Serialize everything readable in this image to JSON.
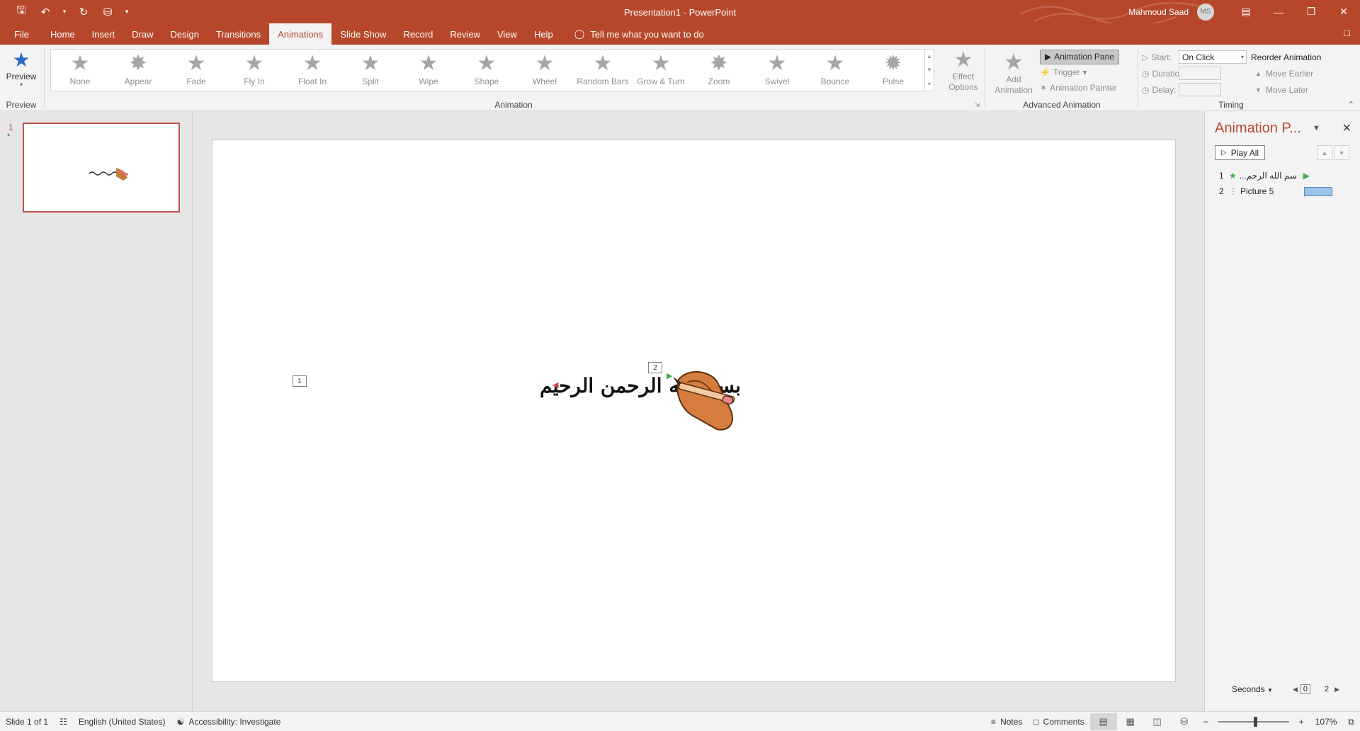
{
  "titlebar": {
    "doc_title": "Presentation1  -  PowerPoint",
    "user_name": "Mahmoud Saad",
    "user_initials": "MS"
  },
  "tabs": {
    "file": "File",
    "items": [
      "Home",
      "Insert",
      "Draw",
      "Design",
      "Transitions",
      "Animations",
      "Slide Show",
      "Record",
      "Review",
      "View",
      "Help"
    ],
    "active": "Animations",
    "tell_me": "Tell me what you want to do"
  },
  "ribbon": {
    "preview": {
      "label": "Preview",
      "group": "Preview"
    },
    "animation_group": "Animation",
    "gallery": [
      "None",
      "Appear",
      "Fade",
      "Fly In",
      "Float In",
      "Split",
      "Wipe",
      "Shape",
      "Wheel",
      "Random Bars",
      "Grow & Turn",
      "Zoom",
      "Swivel",
      "Bounce",
      "Pulse"
    ],
    "effect_options": "Effect Options",
    "advanced": {
      "group": "Advanced Animation",
      "add_animation": "Add Animation",
      "animation_pane": "Animation Pane",
      "trigger": "Trigger",
      "animation_painter": "Animation Painter"
    },
    "timing": {
      "group": "Timing",
      "start_label": "Start:",
      "start_value": "On Click",
      "duration_label": "Duration:",
      "delay_label": "Delay:",
      "reorder": "Reorder Animation",
      "move_earlier": "Move Earlier",
      "move_later": "Move Later"
    }
  },
  "thumbnails": {
    "number": "1",
    "star": "*"
  },
  "slide": {
    "tag1": "1",
    "tag2": "2",
    "calligraphy": "بسم الله الرحمن الرحيم"
  },
  "anim_pane": {
    "title": "Animation P...",
    "play_all": "Play All",
    "items": [
      {
        "num": "1",
        "name": "...بسم الله الرحم",
        "effect_color": "#3fae49"
      },
      {
        "num": "2",
        "name": "Picture 5",
        "effect_color": "#9dc3e6"
      }
    ],
    "seconds": "Seconds",
    "timeline_start": "0",
    "timeline_end": "2"
  },
  "statusbar": {
    "slide_info": "Slide 1 of 1",
    "language": "English (United States)",
    "accessibility": "Accessibility: Investigate",
    "notes": "Notes",
    "comments": "Comments",
    "zoom": "107%"
  },
  "colors": {
    "accent": "#b7472a",
    "ribbon_bg": "#f3f3f3"
  }
}
